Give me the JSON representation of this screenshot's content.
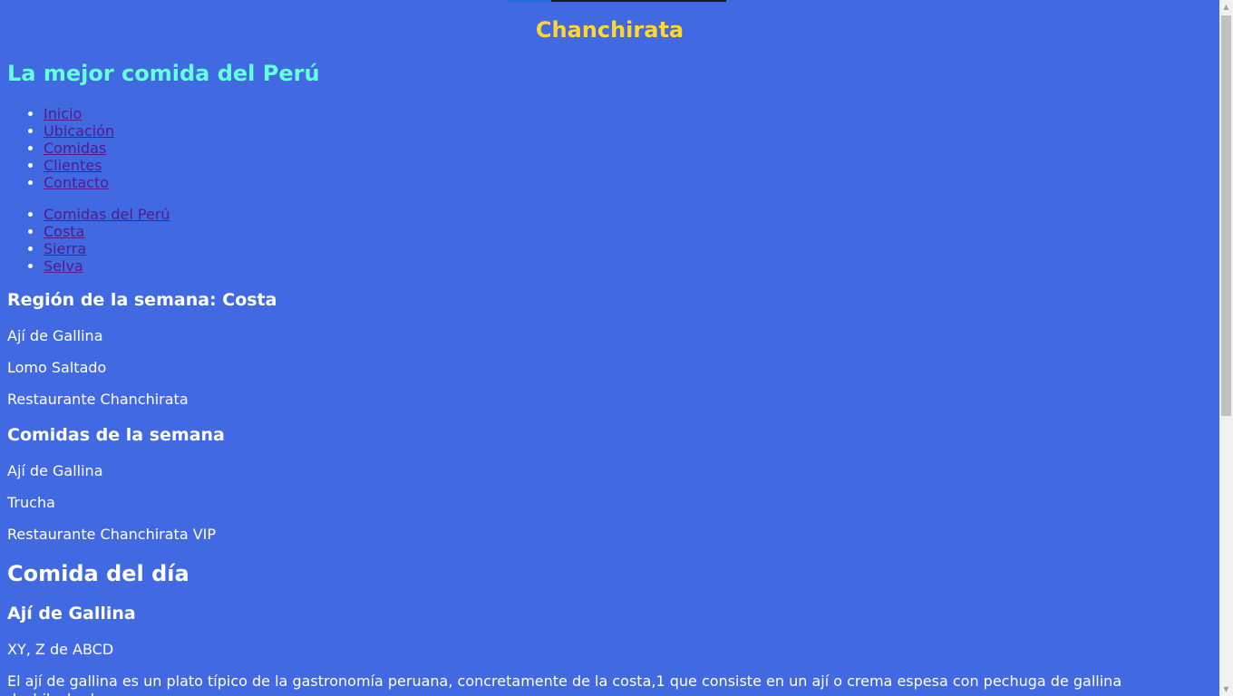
{
  "header": {
    "title": "Chanchirata",
    "tagline": "La mejor comida del Perú"
  },
  "nav_main": [
    "Inicio",
    "Ubicación",
    "Comidas",
    "Clientes",
    "Contacto"
  ],
  "nav_regions": [
    "Comidas del Perú",
    "Costa",
    "Sierra",
    "Selva"
  ],
  "region_week": {
    "heading": "Región de la semana: Costa",
    "items": [
      "Ají de Gallina",
      "Lomo Saltado",
      "Restaurante Chanchirata"
    ]
  },
  "foods_week": {
    "heading": "Comidas de la semana",
    "items": [
      "Ají de Gallina",
      "Trucha",
      "Restaurante Chanchirata VIP"
    ]
  },
  "food_of_day": {
    "heading": "Comida del día",
    "dish": "Ají de Gallina",
    "byline": "XY, Z de ABCD",
    "description": "El ají de gallina es un plato típico de la gastronomía peruana, concretamente de la costa,1 que consiste en un ají o crema espesa con pechuga de gallina deshilachada."
  },
  "colors": {
    "background": "#4169e1",
    "title": "#ffd633",
    "tagline": "#66ffdd",
    "link": "#551a8b"
  }
}
